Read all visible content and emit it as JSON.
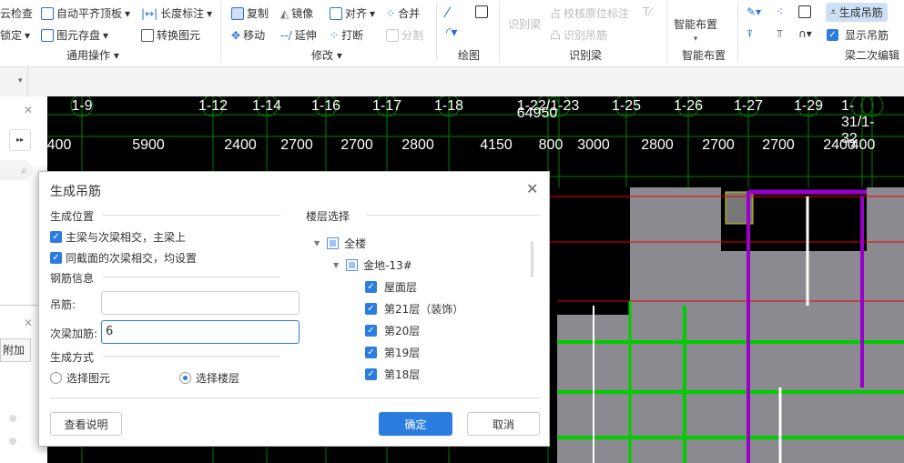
{
  "ribbon": {
    "general": {
      "items": [
        "云检查",
        "锁定",
        "自动平齐顶板",
        "图元存盘",
        "长度标注",
        "转换图元"
      ],
      "label": "通用操作"
    },
    "modify": {
      "items": [
        "复制",
        "镜像",
        "对齐",
        "合并",
        "移动",
        "延伸",
        "打断",
        "分割"
      ],
      "label": "修改"
    },
    "draw": {
      "label": "绘图"
    },
    "identify": {
      "items": [
        "识别梁",
        "校核原位标注",
        "识别吊筋"
      ],
      "label": "识别梁"
    },
    "smart": {
      "items": [
        "智能布置"
      ],
      "label": "智能布置"
    },
    "edit": {
      "items": [
        "生成吊筋",
        "显示吊筋"
      ],
      "label": "梁二次编辑",
      "show_hanger_checked": true
    }
  },
  "left_panel": {
    "tab_label": "附加"
  },
  "canvas": {
    "axes": [
      "1-9",
      "1-12",
      "1-14",
      "1-16",
      "1-17",
      "1-18",
      "1-22",
      "1-23",
      "1-25",
      "1-26",
      "1-27",
      "1-29",
      "1-31",
      "1-32"
    ],
    "total": "64950",
    "dims": [
      "400",
      "5900",
      "2400",
      "2700",
      "2700",
      "2800",
      "4150",
      "800",
      "3000",
      "2800",
      "2700",
      "2700",
      "2400",
      "400"
    ]
  },
  "dialog": {
    "title": "生成吊筋",
    "position_section": "生成位置",
    "opt1": "主梁与次梁相交，主梁上",
    "opt1_checked": true,
    "opt2": "同截面的次梁相交，均设置",
    "opt2_checked": true,
    "rebar_section": "钢筋信息",
    "hanger_label": "吊筋:",
    "hanger_value": "",
    "extra_label": "次梁加筋:",
    "extra_value": "6",
    "method_section": "生成方式",
    "method1": "选择图元",
    "method2": "选择楼层",
    "method_selected": "选择楼层",
    "floor_section": "楼层选择",
    "tree_root": "全楼",
    "tree_building": "金地-13#",
    "floors": [
      {
        "name": "屋面层",
        "checked": true
      },
      {
        "name": "第21层（装饰）",
        "checked": true
      },
      {
        "name": "第20层",
        "checked": true
      },
      {
        "name": "第19层",
        "checked": true
      },
      {
        "name": "第18层",
        "checked": true
      }
    ],
    "help_button": "查看说明",
    "ok_button": "确定",
    "cancel_button": "取消"
  },
  "colors": {
    "accent": "#2b7de0",
    "arrow": "#f0506e",
    "canvas_bg": "#000000",
    "grid": "#008000"
  }
}
